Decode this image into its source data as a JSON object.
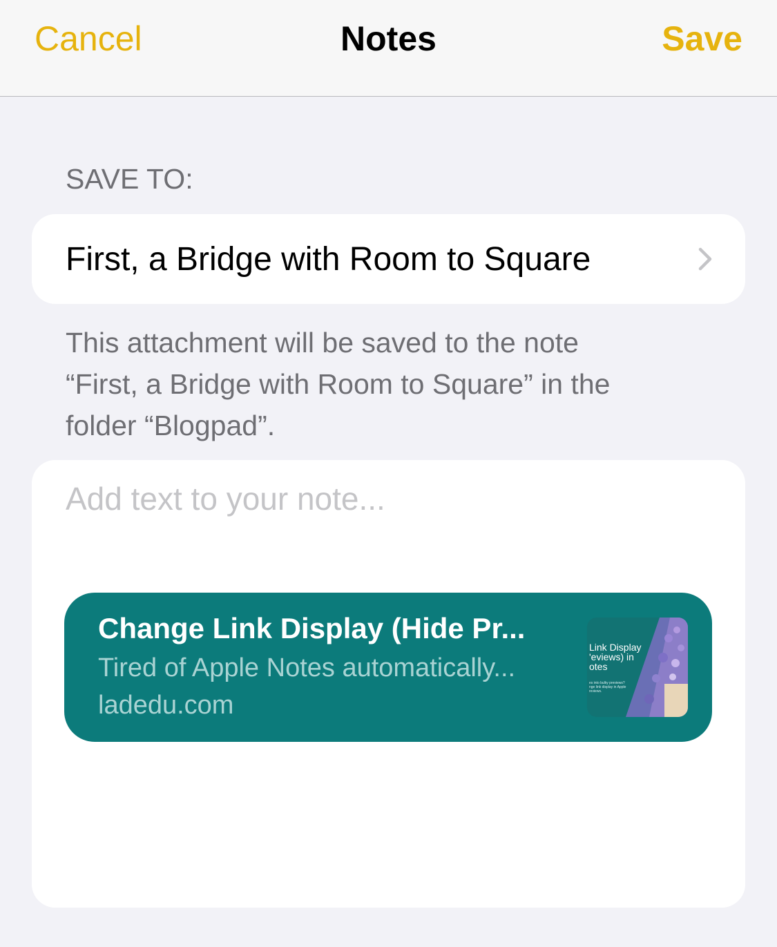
{
  "navbar": {
    "cancel_label": "Cancel",
    "title": "Notes",
    "save_label": "Save"
  },
  "save_to": {
    "header": "SAVE TO:",
    "note_title": "First, a Bridge with Room to Square",
    "chevron_icon": "chevron-right-icon",
    "footer_line1": "This attachment will be saved to the note",
    "footer_line2": "“First, a Bridge with Room to Square” in the",
    "footer_line3": "folder “Blogpad”."
  },
  "editor": {
    "placeholder": "Add text to your note...",
    "value": ""
  },
  "link_preview": {
    "title": "Change Link Display (Hide Pr...",
    "description": "Tired of Apple Notes automatically...",
    "domain": "ladedu.com",
    "thumbnail": {
      "line1": "Link Display",
      "line2": "'eviews) in",
      "line3": "otes",
      "small1": "es into bulky previews?",
      "small2": "nge link display in Apple",
      "small3": "reviews."
    }
  },
  "colors": {
    "accent": "#e6b30e",
    "card": "#0c7b7b",
    "background": "#f2f2f7"
  }
}
